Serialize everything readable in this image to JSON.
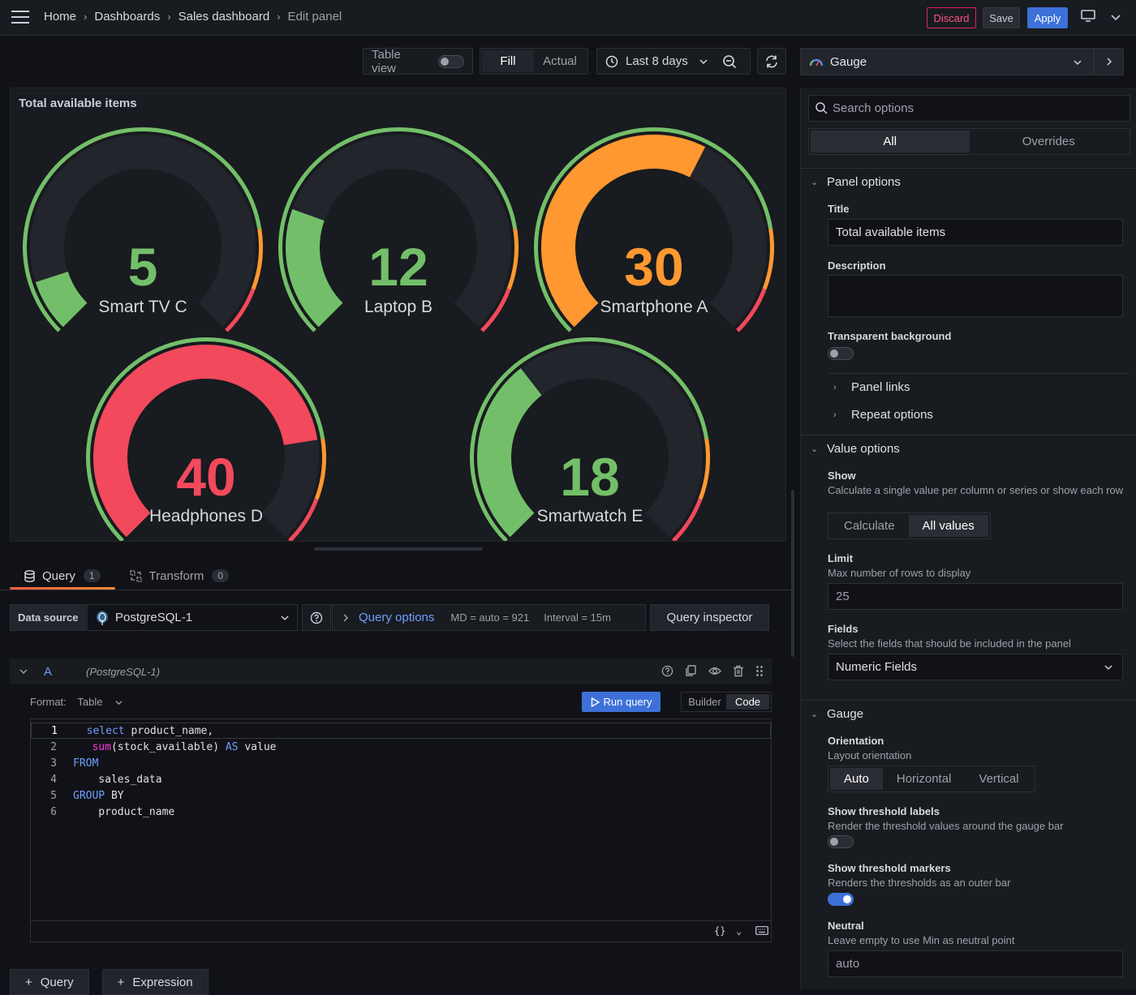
{
  "topbar": {
    "breadcrumbs": [
      "Home",
      "Dashboards",
      "Sales dashboard",
      "Edit panel"
    ],
    "discard_label": "Discard",
    "save_label": "Save",
    "apply_label": "Apply"
  },
  "toolbar": {
    "table_view_label": "Table view",
    "fill_label": "Fill",
    "actual_label": "Actual",
    "time_range": "Last 8 days"
  },
  "panel": {
    "title": "Total available items",
    "gauges": [
      {
        "name": "Smart TV C",
        "value": "5",
        "value_num": 5,
        "color": "#73bf69"
      },
      {
        "name": "Laptop B",
        "value": "12",
        "value_num": 12,
        "color": "#73bf69"
      },
      {
        "name": "Smartphone A",
        "value": "30",
        "value_num": 30,
        "color": "#ff9830"
      },
      {
        "name": "Headphones D",
        "value": "40",
        "value_num": 40,
        "color": "#f2495c"
      },
      {
        "name": "Smartwatch E",
        "value": "18",
        "value_num": 18,
        "color": "#73bf69"
      }
    ]
  },
  "query_tabs": {
    "query_label": "Query",
    "query_count": "1",
    "transform_label": "Transform",
    "transform_count": "0"
  },
  "datasource": {
    "label": "Data source",
    "value": "PostgreSQL-1",
    "query_options_label": "Query options",
    "md": "MD = auto = 921",
    "interval": "Interval = 15m",
    "inspector_label": "Query inspector"
  },
  "query": {
    "letter": "A",
    "ds_name": "(PostgreSQL-1)",
    "format_label": "Format:",
    "format_value": "Table",
    "run_label": "Run query",
    "builder_label": "Builder",
    "code_label": "Code",
    "line_numbers": [
      "1",
      "2",
      "3",
      "4",
      "5",
      "6"
    ]
  },
  "add": {
    "query_label": "Query",
    "expression_label": "Expression"
  },
  "options": {
    "viz": "Gauge",
    "search_placeholder": "Search options",
    "all_label": "All",
    "overrides_label": "Overrides",
    "panel_options": {
      "heading": "Panel options",
      "title_label": "Title",
      "title_value": "Total available items",
      "description_label": "Description",
      "transparent_label": "Transparent background",
      "panel_links": "Panel links",
      "repeat_options": "Repeat options"
    },
    "value_options": {
      "heading": "Value options",
      "show_label": "Show",
      "show_desc": "Calculate a single value per column or series or show each row",
      "calculate_label": "Calculate",
      "all_values_label": "All values",
      "limit_label": "Limit",
      "limit_desc": "Max number of rows to display",
      "limit_value": "25",
      "fields_label": "Fields",
      "fields_desc": "Select the fields that should be included in the panel",
      "fields_value": "Numeric Fields"
    },
    "gauge": {
      "heading": "Gauge",
      "orientation_label": "Orientation",
      "orientation_desc": "Layout orientation",
      "auto_label": "Auto",
      "horizontal_label": "Horizontal",
      "vertical_label": "Vertical",
      "threshold_labels_label": "Show threshold labels",
      "threshold_labels_desc": "Render the threshold values around the gauge bar",
      "threshold_markers_label": "Show threshold markers",
      "threshold_markers_desc": "Renders the thresholds as an outer bar",
      "neutral_label": "Neutral",
      "neutral_desc": "Leave empty to use Min as neutral point",
      "neutral_placeholder": "auto"
    }
  },
  "colors": {
    "green": "#73bf69",
    "orange": "#ff9830",
    "red": "#f2495c",
    "blue": "#3d71d9"
  }
}
